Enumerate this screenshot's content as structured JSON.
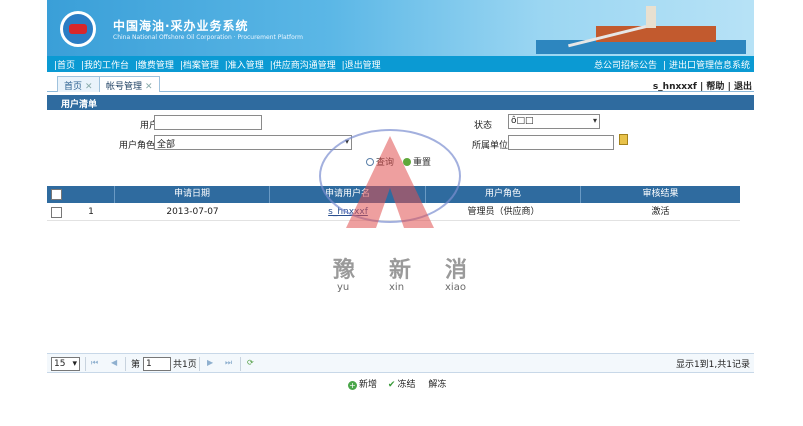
{
  "header": {
    "title": "中国海油·采办业务系统",
    "subtitle": "China National Offshore Oil Corporation · Procurement Platform"
  },
  "nav": {
    "left_items": [
      "首页",
      "我的工作台",
      "缴费管理",
      "档案管理",
      "准入管理",
      "供应商沟通管理",
      "退出管理"
    ],
    "right_items": [
      "总公司招标公告",
      "进出口管理信息系统"
    ]
  },
  "tabs": [
    {
      "label": "首页"
    },
    {
      "label": "帐号管理"
    }
  ],
  "user_bar": {
    "username": "s_hnxxxf",
    "help": "帮助",
    "logout": "退出"
  },
  "section": {
    "title": "用户清单"
  },
  "search": {
    "username_label": "用户名",
    "username_value": "",
    "role_label": "用户角色",
    "role_value": "全部",
    "status_label": "状态",
    "status_value": "ô□□",
    "org_label": "所属单位",
    "org_value": "",
    "query_label": "查询",
    "reset_label": "重置"
  },
  "table": {
    "columns": [
      "申请日期",
      "申请用户名",
      "用户角色",
      "审核结果"
    ],
    "rows": [
      {
        "index": "1",
        "date": "2013-07-07",
        "username": "s_hnxxxf",
        "role": "管理员（供应商）",
        "result": "激活"
      }
    ]
  },
  "watermark": {
    "chars": [
      "豫",
      "新",
      "消"
    ],
    "pinyin": [
      "yu",
      "xin",
      "xiao"
    ],
    "accent": "#e05050"
  },
  "pager": {
    "page_size": "15",
    "page_prefix": "第",
    "page_value": "1",
    "page_suffix": "共1页",
    "summary": "显示1到1,共1记录"
  },
  "actions": {
    "add": "新增",
    "freeze": "冻结",
    "unfreeze": "解冻"
  }
}
